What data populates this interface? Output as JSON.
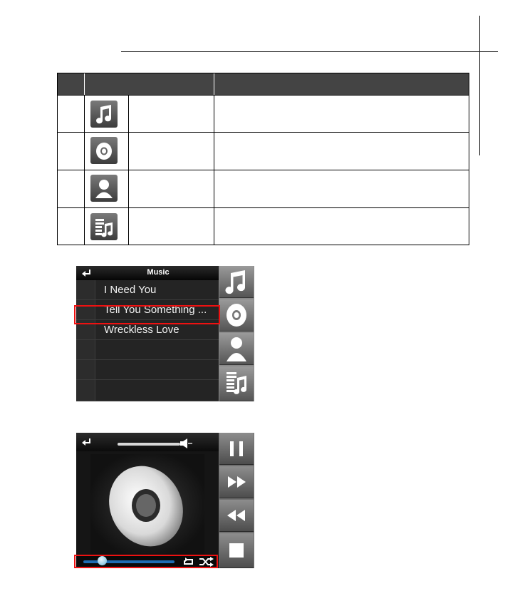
{
  "music_screen": {
    "title": "Music",
    "songs": [
      "I Need You",
      "Tell You Something ...",
      "Wreckless Love",
      "",
      "",
      ""
    ],
    "side_buttons": [
      "music-note-icon",
      "disc-icon",
      "artist-icon",
      "playlist-icon"
    ]
  },
  "player_screen": {
    "volume_level": 0.85,
    "progress": 0.21,
    "controls": [
      "pause-icon",
      "fast-forward-icon",
      "rewind-icon",
      "stop-icon"
    ]
  },
  "icon_table": {
    "icons": [
      "music-note-icon",
      "disc-icon",
      "artist-icon",
      "playlist-icon"
    ]
  },
  "colors": {
    "highlight": "#ee1111",
    "progress": "#1e6db3"
  }
}
